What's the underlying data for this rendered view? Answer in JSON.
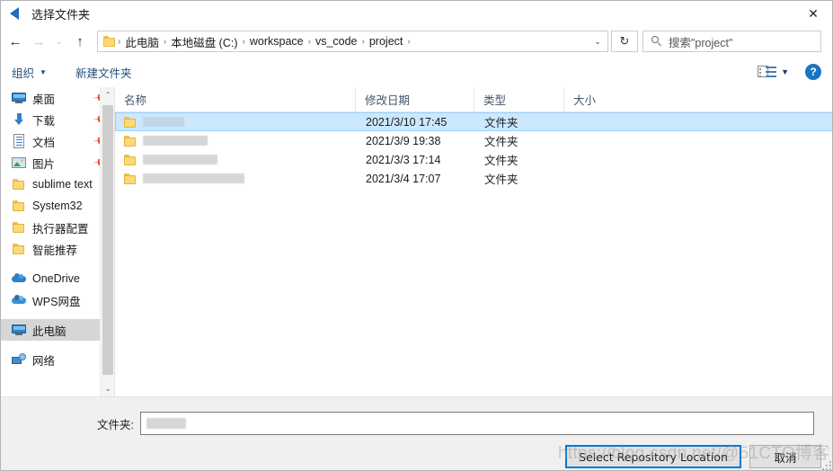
{
  "window": {
    "title": "选择文件夹",
    "title_icon": "folder-select-icon",
    "close_label": "✕"
  },
  "nav": {
    "back_icon": "←",
    "forward_icon": "→",
    "recent_icon": "⌄",
    "up_icon": "↑",
    "refresh_icon": "↻",
    "dropdown_icon": "⌄",
    "breadcrumbs": [
      {
        "label": "此电脑"
      },
      {
        "label": "本地磁盘 (C:)"
      },
      {
        "label": "workspace"
      },
      {
        "label": "vs_code"
      },
      {
        "label": "project"
      }
    ],
    "separator": "›"
  },
  "search": {
    "placeholder": "搜索\"project\"",
    "value": "搜索\"project\"",
    "icon": "search-icon"
  },
  "commandbar": {
    "organize_label": "组织",
    "organize_caret": "▼",
    "new_folder_label": "新建文件夹",
    "view_caret": "▼",
    "help_label": "?"
  },
  "sidebar": {
    "quick_access": [
      {
        "label": "桌面",
        "icon": "desktop-icon",
        "pinned": true
      },
      {
        "label": "下载",
        "icon": "download-icon",
        "pinned": true
      },
      {
        "label": "文档",
        "icon": "documents-icon",
        "pinned": true
      },
      {
        "label": "图片",
        "icon": "pictures-icon",
        "pinned": true
      },
      {
        "label": "sublime text",
        "icon": "folder-icon",
        "pinned": false
      },
      {
        "label": "System32",
        "icon": "folder-icon",
        "pinned": false
      },
      {
        "label": "执行器配置",
        "icon": "folder-icon",
        "pinned": false
      },
      {
        "label": "智能推荐",
        "icon": "folder-icon",
        "pinned": false
      }
    ],
    "cloud": [
      {
        "label": "OneDrive",
        "icon": "onedrive-cloud-icon"
      },
      {
        "label": "WPS网盘",
        "icon": "wps-cloud-icon"
      }
    ],
    "computer": {
      "label": "此电脑",
      "icon": "this-pc-icon",
      "selected": true
    },
    "network": {
      "label": "网络",
      "icon": "network-icon",
      "selected": false
    },
    "pin_glyph": "📌",
    "scroll_up": "⌃",
    "scroll_down": "⌄"
  },
  "filelist": {
    "columns": [
      {
        "key": "name",
        "label": "名称",
        "sorted": "asc",
        "sort_glyph": "⌃"
      },
      {
        "key": "date",
        "label": "修改日期"
      },
      {
        "key": "type",
        "label": "类型"
      },
      {
        "key": "size",
        "label": "大小"
      }
    ],
    "rows": [
      {
        "name": "",
        "name_redacted": true,
        "redact_width": 46,
        "date": "2021/3/10 17:45",
        "type": "文件夹",
        "size": "",
        "selected": true
      },
      {
        "name": "",
        "name_redacted": true,
        "redact_width": 72,
        "date": "2021/3/9 19:38",
        "type": "文件夹",
        "size": "",
        "selected": false
      },
      {
        "name": "",
        "name_redacted": true,
        "redact_width": 83,
        "date": "2021/3/3 17:14",
        "type": "文件夹",
        "size": "",
        "selected": false
      },
      {
        "name": "",
        "name_redacted": true,
        "redact_width": 113,
        "date": "2021/3/4 17:07",
        "type": "文件夹",
        "size": "",
        "selected": false
      }
    ]
  },
  "footer": {
    "folder_label": "文件夹:",
    "folder_value": "",
    "folder_value_redacted": true,
    "select_button": "Select Repository Location",
    "cancel_button": "取消"
  },
  "watermark": {
    "text": "https://blog.csdn.net/@51CTO博客"
  },
  "colors": {
    "accent": "#0078d7",
    "selection": "#cce8ff",
    "selection_border": "#99d1ff",
    "sidebar_selected": "#d6d6d6",
    "folder_yellow": "#fbd978",
    "link_blue": "#1f4e79",
    "footer_bg": "#f0f0f0"
  }
}
